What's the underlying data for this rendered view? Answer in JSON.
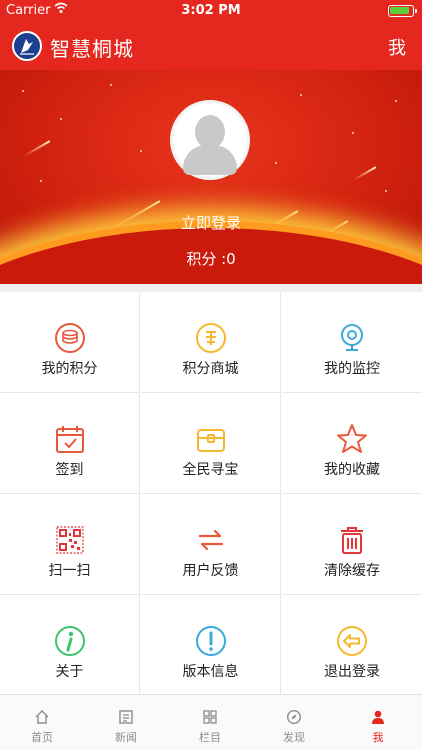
{
  "status_bar": {
    "carrier": "Carrier",
    "time": "3:02 PM"
  },
  "header": {
    "title": "智慧桐城",
    "right_label": "我"
  },
  "profile": {
    "login_label": "立即登录",
    "points_label": "积分 :0"
  },
  "menu": [
    {
      "label": "我的积分",
      "icon": "coins-icon",
      "color": "#e8583b"
    },
    {
      "label": "积分商城",
      "icon": "shopping-coin-icon",
      "color": "#f5b82e"
    },
    {
      "label": "我的监控",
      "icon": "camera-icon",
      "color": "#3aa8d8"
    },
    {
      "label": "签到",
      "icon": "calendar-check-icon",
      "color": "#e8583b"
    },
    {
      "label": "全民寻宝",
      "icon": "treasure-chest-icon",
      "color": "#f5b82e"
    },
    {
      "label": "我的收藏",
      "icon": "star-icon",
      "color": "#e8583b"
    },
    {
      "label": "扫一扫",
      "icon": "qr-code-icon",
      "color": "#e0383a"
    },
    {
      "label": "用户反馈",
      "icon": "feedback-arrows-icon",
      "color": "#e8583b"
    },
    {
      "label": "清除缓存",
      "icon": "trash-icon",
      "color": "#e0383a"
    },
    {
      "label": "关于",
      "icon": "info-icon",
      "color": "#3cc66a"
    },
    {
      "label": "版本信息",
      "icon": "alert-icon",
      "color": "#3aa8d8"
    },
    {
      "label": "退出登录",
      "icon": "logout-icon",
      "color": "#f5b82e"
    }
  ],
  "tabs": [
    {
      "label": "首页",
      "icon": "home-icon",
      "active": false
    },
    {
      "label": "新闻",
      "icon": "news-icon",
      "active": false
    },
    {
      "label": "栏目",
      "icon": "grid-icon",
      "active": false
    },
    {
      "label": "发现",
      "icon": "compass-icon",
      "active": false
    },
    {
      "label": "我",
      "icon": "person-icon",
      "active": true
    }
  ],
  "colors": {
    "brand": "#e4271f",
    "active_tab": "#e4271f",
    "inactive_tab": "#8c8c8c"
  }
}
